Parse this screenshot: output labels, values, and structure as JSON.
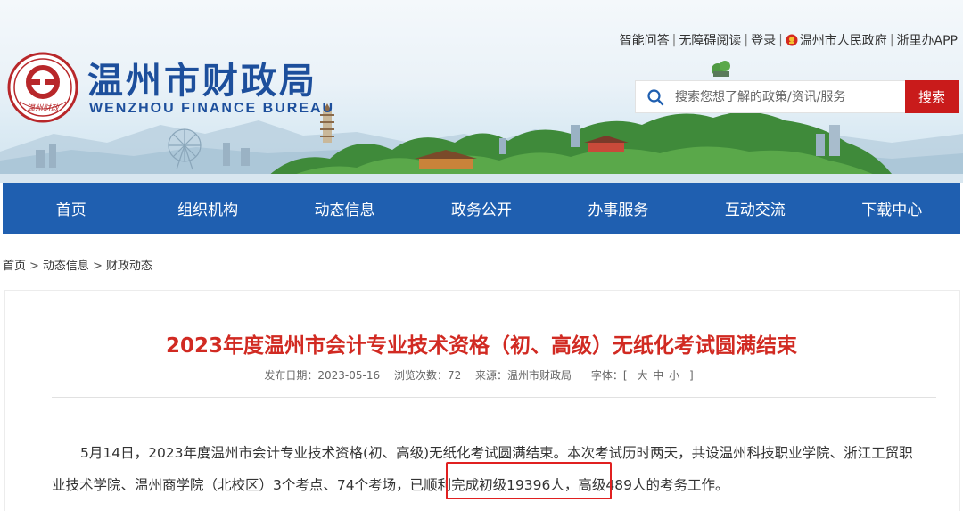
{
  "header": {
    "title_cn": "温州市财政局",
    "title_en": "WENZHOU FINANCE BUREAU",
    "logo_text": "温州财政",
    "top_links": [
      "智能问答",
      "无障碍阅读",
      "登录",
      "温州市人民政府",
      "浙里办APP"
    ],
    "search_placeholder": "搜索您想了解的政策/资讯/服务",
    "search_button": "搜索"
  },
  "nav": {
    "items": [
      "首页",
      "组织机构",
      "动态信息",
      "政务公开",
      "办事服务",
      "互动交流",
      "下载中心"
    ]
  },
  "breadcrumb": {
    "items": [
      "首页",
      "动态信息",
      "财政动态"
    ],
    "separator": ">"
  },
  "article": {
    "title": "2023年度温州市会计专业技术资格（初、高级）无纸化考试圆满结束",
    "publish_date": "发布日期：2023-05-16",
    "views": "浏览次数：72",
    "source": "来源：温州市财政局",
    "font_size_label": "字体：[",
    "font_sizes": [
      "大",
      "中",
      "小"
    ],
    "font_size_end": "]",
    "paragraph": "5月14日，2023年度温州市会计专业技术资格(初、高级)无纸化考试圆满结束。本次考试历时两天，共设温州科技职业学院、浙江工贸职业技术学院、温州商学院（北校区）3个考点、74个考场，已顺利完成初级19396人，高级489人的考务工作。"
  },
  "colors": {
    "brand_blue": "#1d4f9c",
    "nav_blue": "#1f5fb0",
    "title_red": "#d12a22",
    "search_red": "#c91b1b",
    "highlight_red": "#e02020"
  },
  "icons": {
    "logo": "finance-seal-icon",
    "search": "search-icon",
    "emblem": "national-emblem-icon"
  }
}
